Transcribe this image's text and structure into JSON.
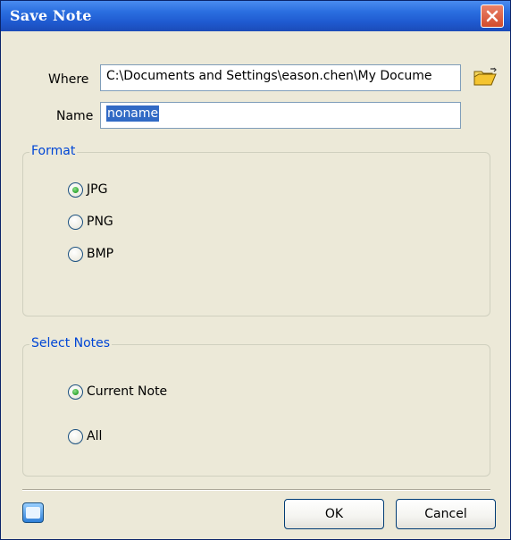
{
  "window": {
    "title": "Save Note"
  },
  "where": {
    "label": "Where",
    "value": "C:\\Documents and Settings\\eason.chen\\My Docume"
  },
  "name": {
    "label": "Name",
    "value": "noname"
  },
  "format": {
    "legend": "Format",
    "options": [
      {
        "label": "JPG",
        "selected": true
      },
      {
        "label": "PNG",
        "selected": false
      },
      {
        "label": "BMP",
        "selected": false
      }
    ]
  },
  "select_notes": {
    "legend": "Select Notes",
    "options": [
      {
        "label": "Current Note",
        "selected": true
      },
      {
        "label": "All",
        "selected": false
      }
    ]
  },
  "buttons": {
    "ok": "OK",
    "cancel": "Cancel"
  },
  "icons": {
    "close": "close-icon",
    "browse": "open-folder-icon",
    "keyboard": "keyboard-icon"
  },
  "colors": {
    "titlebar": "#2b6fe0",
    "dialog_bg": "#ece9d8",
    "legend_text": "#0046d5",
    "selection": "#316ac5",
    "close_button": "#d24b2b"
  }
}
